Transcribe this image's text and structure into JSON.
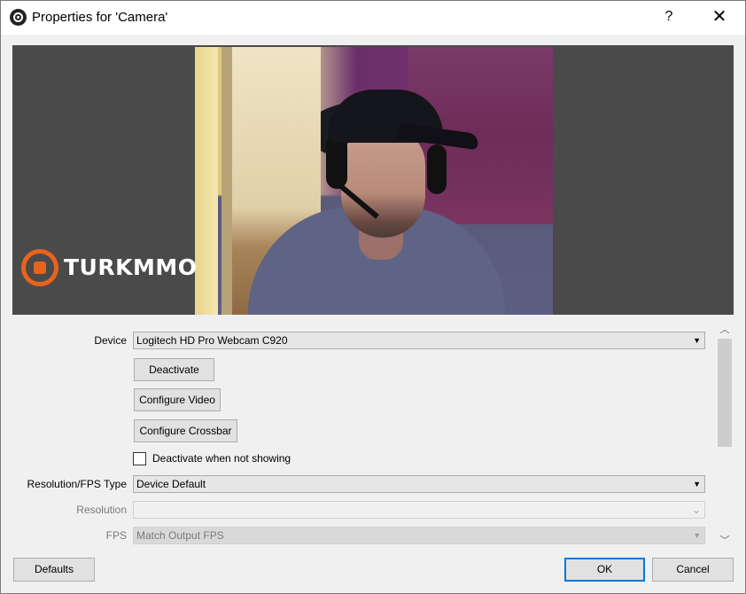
{
  "window": {
    "title": "Properties for 'Camera'",
    "help_label": "?",
    "close_label": "✕"
  },
  "preview": {
    "watermark_text": "TURKMMO"
  },
  "properties": {
    "device": {
      "label": "Device",
      "value": "Logitech HD Pro Webcam C920"
    },
    "deactivate_button": "Deactivate",
    "configure_video_button": "Configure Video",
    "configure_crossbar_button": "Configure Crossbar",
    "deactivate_when_not_showing": {
      "label": "Deactivate when not showing",
      "checked": false
    },
    "resolution_fps_type": {
      "label": "Resolution/FPS Type",
      "value": "Device Default"
    },
    "resolution": {
      "label": "Resolution",
      "value": ""
    },
    "fps": {
      "label": "FPS",
      "value": "Match Output FPS"
    }
  },
  "footer": {
    "defaults_button": "Defaults",
    "ok_button": "OK",
    "cancel_button": "Cancel"
  },
  "colors": {
    "accent": "#0078d7",
    "preview_background": "#4a4a4a",
    "watermark_accent": "#e8631c"
  }
}
